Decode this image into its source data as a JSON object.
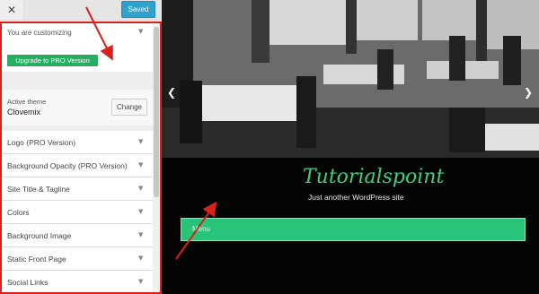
{
  "customizer": {
    "close_label": "✕",
    "saved_label": "Saved",
    "customizing_label": "You are customizing",
    "upgrade_label": "Upgrade to PRO Version",
    "active_theme_label": "Active theme",
    "theme_name": "Clovemix",
    "change_label": "Change",
    "sections": [
      {
        "label": "Logo (PRO Version)"
      },
      {
        "label": "Background Opacity (PRO Version)"
      },
      {
        "label": "Site Title & Tagline"
      },
      {
        "label": "Colors"
      },
      {
        "label": "Background Image"
      },
      {
        "label": "Static Front Page"
      },
      {
        "label": "Social Links"
      }
    ]
  },
  "preview": {
    "site_title": "Tutorialspoint",
    "tagline": "Just another WordPress site",
    "menu_label": "Menu"
  },
  "colors": {
    "accent": "#27ae60",
    "saved_button": "#2ea2cc",
    "annotation_red": "#d9221d",
    "title_green": "#3fcf7e",
    "menu_green": "#27c47a"
  }
}
